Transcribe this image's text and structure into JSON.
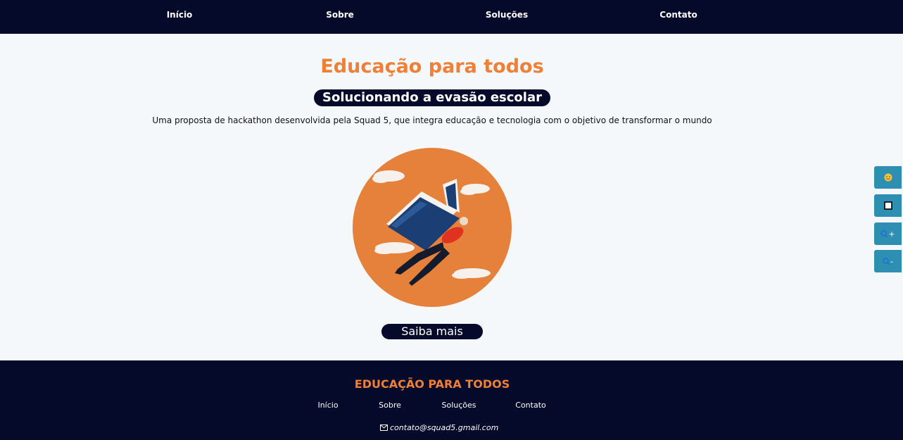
{
  "nav": {
    "items": [
      {
        "label": "Início"
      },
      {
        "label": "Sobre"
      },
      {
        "label": "Soluções"
      },
      {
        "label": "Contato"
      }
    ]
  },
  "hero": {
    "title": "Educação para todos",
    "subtitle": "Solucionando a evasão escolar",
    "description": "Uma proposta de hackathon desenvolvida pela Squad 5, que integra educação e tecnologia com o objetivo de transformar o mundo",
    "cta_label": "Saiba mais"
  },
  "accessibility": {
    "buttons": [
      {
        "icon": "emoji-icon"
      },
      {
        "icon": "contrast-square-icon"
      },
      {
        "icon": "zoom-in-icon",
        "label": "+"
      },
      {
        "icon": "zoom-out-icon",
        "label": "-"
      }
    ]
  },
  "footer": {
    "brand": "EDUCAÇÃO PARA TODOS",
    "links": [
      {
        "label": "Início"
      },
      {
        "label": "Sobre"
      },
      {
        "label": "Soluções"
      },
      {
        "label": "Contato"
      }
    ],
    "email": "contato@squad5.gmail.com"
  },
  "colors": {
    "navy": "#050a2a",
    "accent_orange": "#f07f37",
    "illustration_orange": "#e5813a",
    "accessibility_blue": "#2f8fb2",
    "background": "#f5f8fb"
  }
}
